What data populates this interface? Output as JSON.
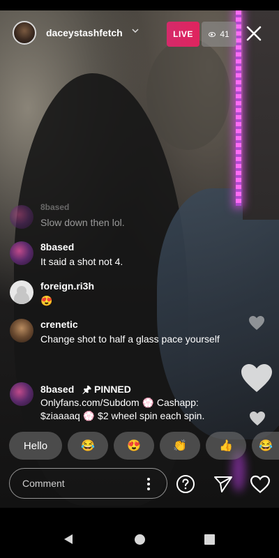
{
  "header": {
    "username": "daceystashfetch",
    "live_label": "LIVE",
    "viewer_count": "41"
  },
  "comments": [
    {
      "user": "8based",
      "text": "Slow down then lol."
    },
    {
      "user": "8based",
      "text": "It said a shot not 4."
    },
    {
      "user": "foreign.ri3h",
      "text": "😍"
    },
    {
      "user": "crenetic",
      "text": "Change shot to half a glass pace yourself"
    }
  ],
  "pinned": {
    "user": "8based",
    "pin_label": "PINNED",
    "text": "Onlyfans.com/Subdom 💮 Cashapp: $ziaaaaq 💮 $2 wheel spin each spin."
  },
  "quick_replies": [
    "Hello",
    "😂",
    "😍",
    "👏",
    "👍",
    "😂"
  ],
  "composer": {
    "placeholder": "Comment"
  },
  "icons": {
    "close": "close-icon",
    "eye": "eye-icon",
    "heart": "heart-icon",
    "help": "question-icon",
    "send": "send-icon",
    "like": "heart-outline-icon",
    "more": "more-vertical-icon"
  }
}
